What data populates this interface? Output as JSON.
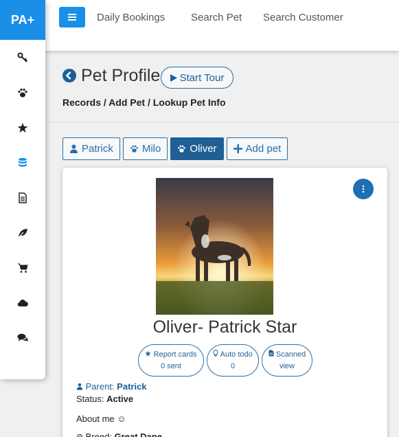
{
  "brand": "PA+",
  "sidebar": {
    "items": [
      {
        "icon": "key-icon"
      },
      {
        "icon": "paw-icon"
      },
      {
        "icon": "star-icon"
      },
      {
        "icon": "database-icon",
        "color": "#1a8fe8"
      },
      {
        "icon": "document-icon"
      },
      {
        "icon": "leaf-icon"
      },
      {
        "icon": "cart-icon"
      },
      {
        "icon": "cloud-icon"
      },
      {
        "icon": "comments-icon"
      }
    ]
  },
  "topnav": {
    "links": [
      "Daily Bookings",
      "Search Pet",
      "Search Customer"
    ]
  },
  "header": {
    "title": "Pet Profile",
    "tour_label": "Start Tour",
    "breadcrumb": "Records / Add Pet / Lookup Pet Info"
  },
  "tabs": [
    {
      "label": "Patrick",
      "icon": "user-icon"
    },
    {
      "label": "Milo",
      "icon": "paw-icon"
    },
    {
      "label": "Oliver",
      "icon": "paw-icon",
      "active": true
    },
    {
      "label": "Add pet",
      "icon": "plus-icon"
    }
  ],
  "profile": {
    "name": "Oliver- Patrick Star",
    "pills": [
      {
        "line1": "Report cards",
        "line2": "0 sent",
        "icon": "star-icon"
      },
      {
        "line1": "Auto todo",
        "line2": "0",
        "icon": "lightbulb-icon"
      },
      {
        "line1": "Scanned",
        "line2": "view",
        "icon": "file-icon"
      }
    ],
    "parent_label": "Parent:",
    "parent_name": "Patrick",
    "status_label": "Status:",
    "status_value": "Active",
    "about": "About me",
    "about_emoji": "☺",
    "breed_label": "Breed:",
    "breed_value": "Great Dane"
  },
  "colors": {
    "primary": "#1a8fe8",
    "dark_blue": "#1f5f94"
  }
}
